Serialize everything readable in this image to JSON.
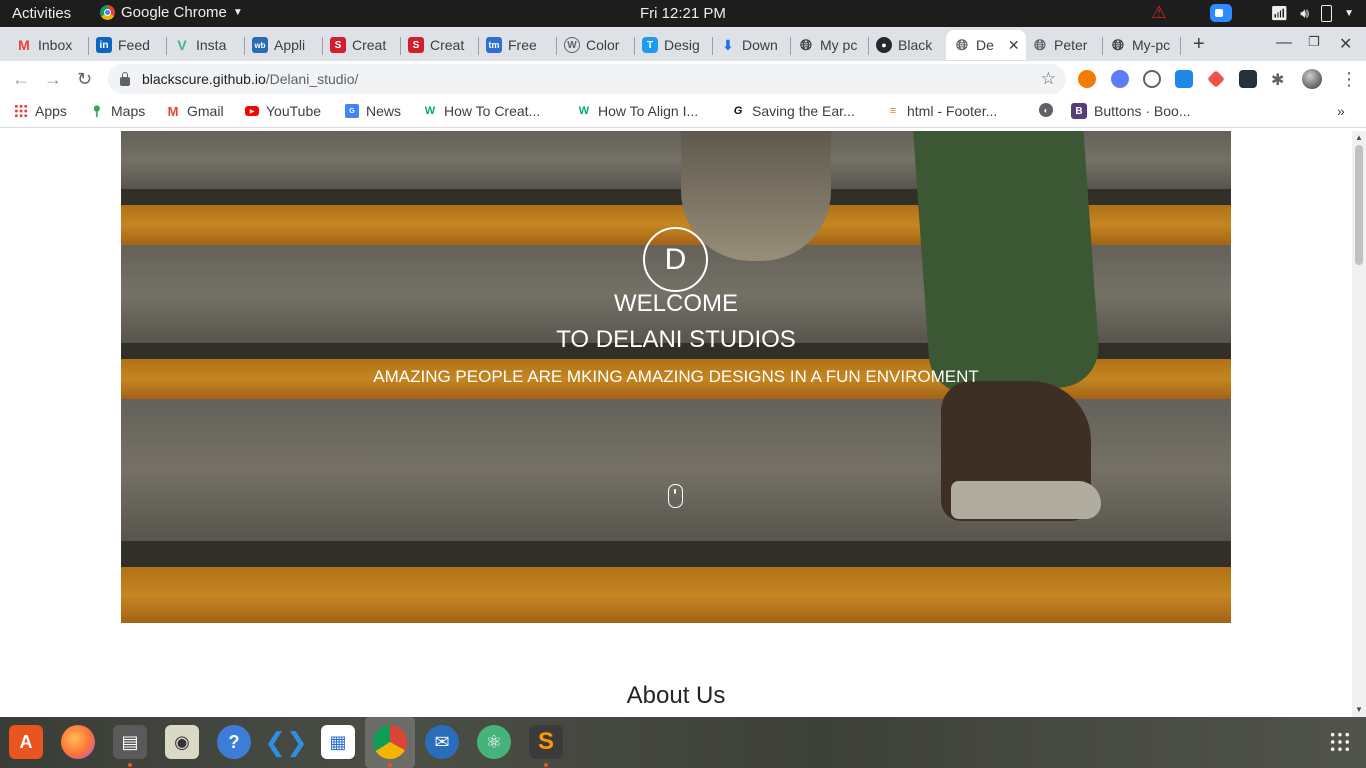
{
  "topbar": {
    "activities": "Activities",
    "app_name": "Google Chrome",
    "clock": "Fri 12:21 PM"
  },
  "tabs": [
    {
      "label": "Inbox",
      "icon": "gmail-icon"
    },
    {
      "label": "Feed",
      "icon": "linkedin-icon"
    },
    {
      "label": "Insta",
      "icon": "vue-icon"
    },
    {
      "label": "Appli",
      "icon": "wb-icon"
    },
    {
      "label": "Creat",
      "icon": "s-icon"
    },
    {
      "label": "Creat",
      "icon": "s-icon"
    },
    {
      "label": "Free",
      "icon": "tm-icon"
    },
    {
      "label": "Color",
      "icon": "wordpress-icon"
    },
    {
      "label": "Desig",
      "icon": "t-icon"
    },
    {
      "label": "Down",
      "icon": "download-icon"
    },
    {
      "label": "My pc",
      "icon": "globe-icon"
    },
    {
      "label": "Black",
      "icon": "github-icon"
    },
    {
      "label": "De",
      "icon": "globe-icon",
      "active": true
    },
    {
      "label": "Peter",
      "icon": "globe-icon"
    },
    {
      "label": "My-pc",
      "icon": "globe-icon"
    }
  ],
  "address": {
    "host": "blackscure.github.io",
    "path": "/Delani_studio/"
  },
  "bookmarks": [
    {
      "label": "Apps",
      "icon": "apps-grid-icon"
    },
    {
      "label": "Maps",
      "icon": "maps-pin-icon"
    },
    {
      "label": "Gmail",
      "icon": "gmail-icon"
    },
    {
      "label": "YouTube",
      "icon": "youtube-icon"
    },
    {
      "label": "News",
      "icon": "news-icon"
    },
    {
      "label": "How To Creat...",
      "icon": "w3schools-icon"
    },
    {
      "label": "How To Align I...",
      "icon": "w3schools-icon"
    },
    {
      "label": "Saving the Ear...",
      "icon": "g-arrow-icon"
    },
    {
      "label": "html - Footer...",
      "icon": "stackoverflow-icon"
    },
    {
      "label": "",
      "icon": "globe-icon"
    },
    {
      "label": "Buttons · Boo...",
      "icon": "bootstrap-icon"
    }
  ],
  "page": {
    "logo_letter": "D",
    "welcome": "WELCOME",
    "to_delani": "TO DELANI STUDIOS",
    "tagline": "AMAZING PEOPLE ARE MKING AMAZING DESIGNS IN A FUN ENVIROMENT",
    "about_title": "About Us"
  },
  "colors": {
    "stair_yellow": "#f0a42a",
    "tab_strip": "#dee1e6",
    "topbar": "#1d1d1d"
  }
}
